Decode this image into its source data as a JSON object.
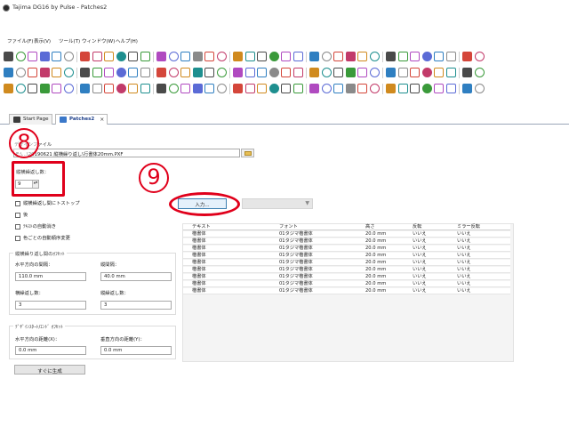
{
  "window": {
    "title": "Tajima DG16 by Pulse - Patches2"
  },
  "menubar": {
    "items": [
      "ファイル(F)",
      "表示(V)",
      "ツール(T)",
      "ウィンドウ(W)",
      "ヘルプ(H)"
    ]
  },
  "tabs": [
    {
      "label": "Start Page",
      "active": false
    },
    {
      "label": "Patches2",
      "active": true,
      "close": "×"
    }
  ],
  "form": {
    "file_section_label": "デザインファイル",
    "file_path": "E:\\...\\20190621 縦横繰り返し\\行書体20mm.PXF",
    "repeat_count_label": "縦横繰返し数：",
    "repeat_count_value": "9",
    "spin_arrows": "▲▼",
    "checkboxes": [
      "縦横繰返し間にトストップ",
      "後",
      "ﾃｷｽﾄの自動消き",
      "色ごとの自動順序変更"
    ],
    "offset_group_title": "縦横繰り返し間のｵﾌｾｯﾄ",
    "h_spacing_label": "水平方向の間隔：",
    "h_spacing_value": "110.0 mm",
    "v_spacing_label": "縦間隔：",
    "v_spacing_value": "40.0 mm",
    "cols_label": "横繰返し数：",
    "cols_value": "3",
    "rows_label": "縦繰返し数：",
    "rows_value": "3",
    "design_offset_title": "ﾃﾞｻﾞｲﾝｽﾀｰﾄ/ｴﾝﾄﾞ ｵﾌｾｯﾄ",
    "h_dist_label": "水平方向の距離(X)：",
    "h_dist_value": "0.0 mm",
    "v_dist_label": "垂直方向の距離(Y)：",
    "v_dist_value": "0.0 mm",
    "input_button": "入力...",
    "combo_arrow": "▼",
    "generate_button": "すぐに生成"
  },
  "table": {
    "headers": [
      "テキスト",
      "フォント",
      "高さ",
      "反転",
      "ミラー反転"
    ],
    "rows": [
      [
        "楷書体",
        "01タジマ楷書体",
        "20.0 mm",
        "いいえ",
        "いいえ"
      ],
      [
        "楷書体",
        "01タジマ楷書体",
        "20.0 mm",
        "いいえ",
        "いいえ"
      ],
      [
        "楷書体",
        "01タジマ楷書体",
        "20.0 mm",
        "いいえ",
        "いいえ"
      ],
      [
        "楷書体",
        "01タジマ楷書体",
        "20.0 mm",
        "いいえ",
        "いいえ"
      ],
      [
        "楷書体",
        "01タジマ楷書体",
        "20.0 mm",
        "いいえ",
        "いいえ"
      ],
      [
        "楷書体",
        "01タジマ楷書体",
        "20.0 mm",
        "いいえ",
        "いいえ"
      ],
      [
        "楷書体",
        "01タジマ楷書体",
        "20.0 mm",
        "いいえ",
        "いいえ"
      ],
      [
        "楷書体",
        "01タジマ楷書体",
        "20.0 mm",
        "いいえ",
        "いいえ"
      ],
      [
        "楷書体",
        "01タジマ楷書体",
        "20.0 mm",
        "いいえ",
        "いいえ"
      ]
    ]
  },
  "annotations": {
    "step_8": "8",
    "step_9": "9",
    "color": "#e0001b"
  },
  "colors": {
    "accent": "#1d3f8a",
    "input_button_border": "#3c7fb1"
  }
}
